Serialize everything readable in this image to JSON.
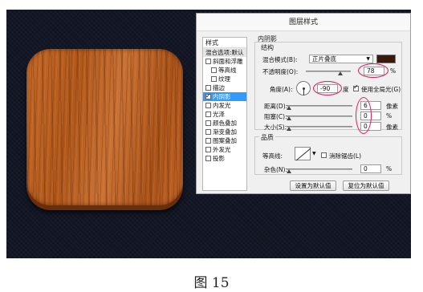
{
  "dialog": {
    "title": "图层样式",
    "styles_header": "样式",
    "blend_options": "混合选项:默认",
    "style_items": [
      {
        "label": "斜面和浮雕",
        "checked": false,
        "indent": false,
        "selected": false
      },
      {
        "label": "等高线",
        "checked": false,
        "indent": true,
        "selected": false
      },
      {
        "label": "纹理",
        "checked": false,
        "indent": true,
        "selected": false
      },
      {
        "label": "描边",
        "checked": false,
        "indent": false,
        "selected": false
      },
      {
        "label": "内阴影",
        "checked": true,
        "indent": false,
        "selected": true
      },
      {
        "label": "内发光",
        "checked": false,
        "indent": false,
        "selected": false
      },
      {
        "label": "光泽",
        "checked": false,
        "indent": false,
        "selected": false
      },
      {
        "label": "颜色叠加",
        "checked": false,
        "indent": false,
        "selected": false
      },
      {
        "label": "渐变叠加",
        "checked": false,
        "indent": false,
        "selected": false
      },
      {
        "label": "图案叠加",
        "checked": false,
        "indent": false,
        "selected": false
      },
      {
        "label": "外发光",
        "checked": false,
        "indent": false,
        "selected": false
      },
      {
        "label": "投影",
        "checked": false,
        "indent": false,
        "selected": false
      }
    ],
    "section_title": "内阴影",
    "structure": {
      "title": "结构",
      "blend_mode_label": "混合模式(B):",
      "blend_mode_value": "正片叠底",
      "shadow_color": "#3b180a",
      "opacity_label": "不透明度(O):",
      "opacity_value": "78",
      "angle_label": "角度(A):",
      "angle_value": "-90",
      "angle_unit": "度",
      "global_light_label": "使用全局光(G)",
      "distance_label": "距离(D):",
      "distance_value": "6",
      "choke_label": "阻塞(C):",
      "choke_value": "0",
      "size_label": "大小(S):",
      "size_value": "0",
      "unit_percent": "%",
      "unit_px": "像素"
    },
    "quality": {
      "title": "品质",
      "contour_label": "等高线:",
      "antialias_label": "消除锯齿(L)",
      "noise_label": "杂色(N):",
      "noise_value": "0"
    },
    "buttons": {
      "set_default": "设置为默认值",
      "reset_default": "复位为默认值"
    }
  },
  "caption": "图 15",
  "colors": {
    "canvas_bg": "#131725",
    "wood": "#b85f24",
    "highlight_circle": "#e0175c",
    "selected_item": "#3399ff"
  }
}
